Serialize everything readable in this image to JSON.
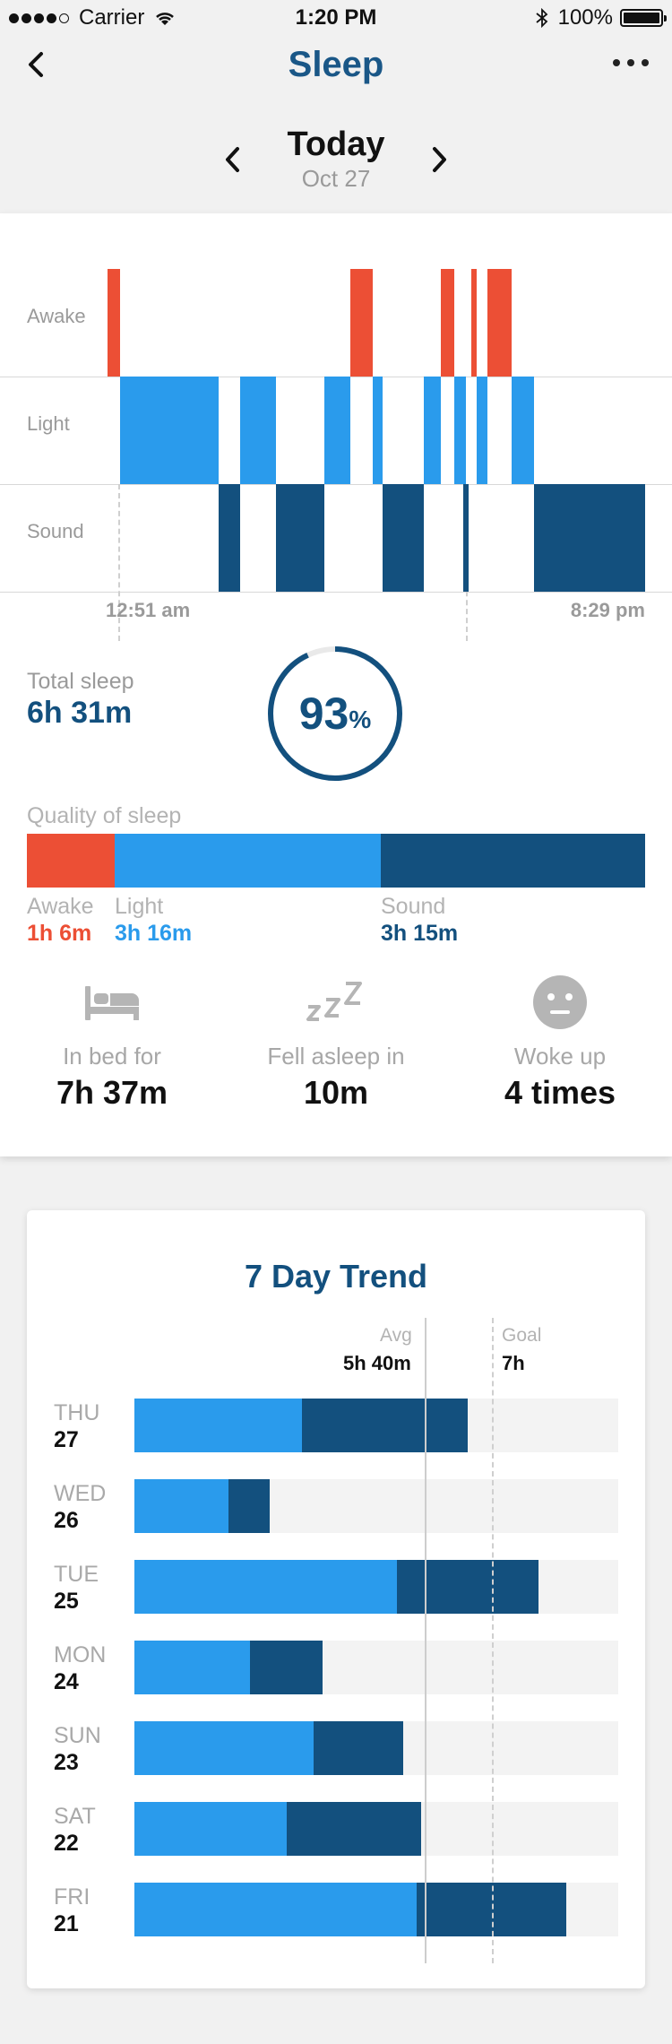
{
  "status_bar": {
    "carrier": "Carrier",
    "time": "1:20 PM",
    "battery": "100%",
    "icons": [
      "signal-dots-icon",
      "wifi-icon",
      "bluetooth-icon",
      "battery-icon"
    ]
  },
  "nav": {
    "title": "Sleep",
    "back_icon": "chevron-left-icon",
    "more_icon": "more-dots-icon"
  },
  "date_nav": {
    "day": "Today",
    "date": "Oct 27"
  },
  "hypnogram": {
    "levels": [
      "Awake",
      "Light",
      "Sound"
    ],
    "start_time": "12:51 am",
    "end_time": "8:29 pm"
  },
  "summary": {
    "total_label": "Total sleep",
    "total_value": "6h 31m",
    "score": "93",
    "score_unit": "%",
    "score_fraction": 0.93
  },
  "quality": {
    "label": "Quality of sleep",
    "segments": [
      {
        "name": "Awake",
        "value": "1h 6m",
        "color": "#ec4f35"
      },
      {
        "name": "Light",
        "value": "3h 16m",
        "color": "#2a9bec"
      },
      {
        "name": "Sound",
        "value": "3h 15m",
        "color": "#13507e"
      }
    ]
  },
  "stats": [
    {
      "label": "In bed for",
      "value": "7h 37m",
      "icon": "bed-icon"
    },
    {
      "label": "Fell asleep in",
      "value": "10m",
      "icon": "zzz-icon"
    },
    {
      "label": "Woke up",
      "value": "4 times",
      "icon": "neutral-face-icon"
    }
  ],
  "trend": {
    "title": "7 Day Trend",
    "avg_label": "Avg",
    "avg_value": "5h 40m",
    "goal_label": "Goal",
    "goal_value": "7h",
    "days": [
      {
        "name": "THU",
        "num": "27"
      },
      {
        "name": "WED",
        "num": "26"
      },
      {
        "name": "TUE",
        "num": "25"
      },
      {
        "name": "MON",
        "num": "24"
      },
      {
        "name": "SUN",
        "num": "23"
      },
      {
        "name": "SAT",
        "num": "22"
      },
      {
        "name": "FRI",
        "num": "21"
      }
    ]
  },
  "colors": {
    "awake": "#ec4f35",
    "light": "#2a9bec",
    "sound": "#13507e",
    "title": "#1a5787"
  }
}
